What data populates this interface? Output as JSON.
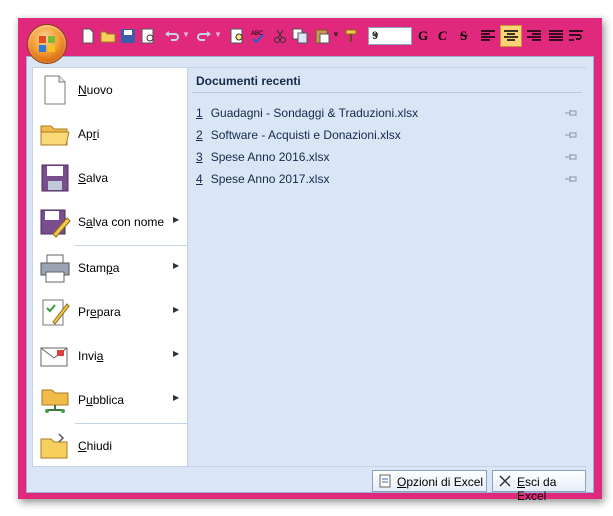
{
  "quick_access": {
    "font_size": "9",
    "bold_label": "G",
    "italic_label": "C",
    "strike_label": "S"
  },
  "menu": {
    "items": [
      {
        "label_pre": "",
        "mnemonic": "N",
        "label_post": "uovo",
        "submenu": false
      },
      {
        "label_pre": "Ap",
        "mnemonic": "r",
        "label_post": "i",
        "submenu": false
      },
      {
        "label_pre": "",
        "mnemonic": "S",
        "label_post": "alva",
        "submenu": false
      },
      {
        "label_pre": "S",
        "mnemonic": "a",
        "label_post": "lva con nome",
        "submenu": true
      },
      {
        "label_pre": "Stam",
        "mnemonic": "p",
        "label_post": "a",
        "submenu": true
      },
      {
        "label_pre": "Pr",
        "mnemonic": "e",
        "label_post": "para",
        "submenu": true
      },
      {
        "label_pre": "Invi",
        "mnemonic": "a",
        "label_post": "",
        "submenu": true
      },
      {
        "label_pre": "P",
        "mnemonic": "u",
        "label_post": "bblica",
        "submenu": true
      },
      {
        "label_pre": "",
        "mnemonic": "C",
        "label_post": "hiudi",
        "submenu": false
      }
    ]
  },
  "recent": {
    "title": "Documenti recenti",
    "docs": [
      {
        "num": "1",
        "name": "Guadagni - Sondaggi & Traduzioni.xlsx"
      },
      {
        "num": "2",
        "name": "Software - Acquisti e Donazioni.xlsx"
      },
      {
        "num": "3",
        "name": "Spese Anno 2016.xlsx"
      },
      {
        "num": "4",
        "name": "Spese Anno 2017.xlsx"
      }
    ]
  },
  "footer": {
    "options_pre": "",
    "options_mn": "O",
    "options_post": "pzioni di Excel",
    "exit_pre": "",
    "exit_mn": "E",
    "exit_post": "sci da Excel"
  },
  "colors": {
    "frame": "#e0287d",
    "menu_bg": "#dae6f5",
    "accent": "#f5a23a"
  }
}
